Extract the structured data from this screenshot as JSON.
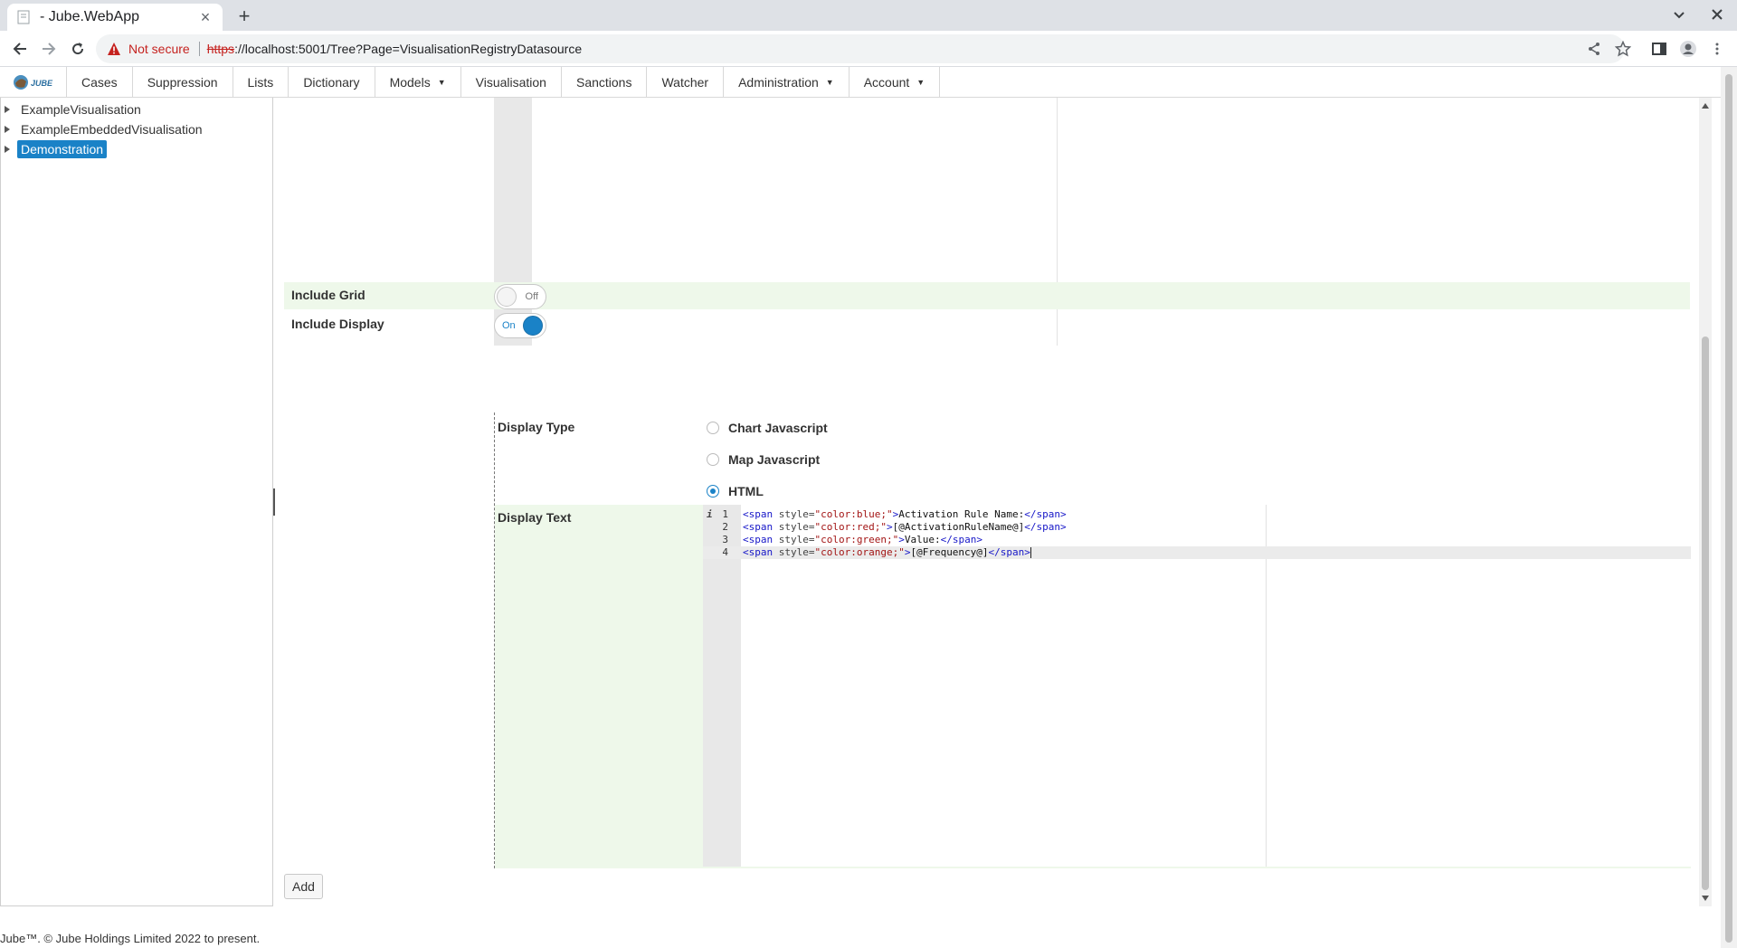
{
  "browser": {
    "tab_title": "- Jube.WebApp",
    "tab_close_icon": "close-icon",
    "new_tab_icon": "plus-icon",
    "security_label": "Not secure",
    "url_scheme": "https",
    "url_rest": "://localhost:5001/Tree?Page=VisualisationRegistryDatasource"
  },
  "menu": {
    "logo_text": "JUBE",
    "items": [
      {
        "label": "Cases",
        "dropdown": false
      },
      {
        "label": "Suppression",
        "dropdown": false
      },
      {
        "label": "Lists",
        "dropdown": false
      },
      {
        "label": "Dictionary",
        "dropdown": false
      },
      {
        "label": "Models",
        "dropdown": true
      },
      {
        "label": "Visualisation",
        "dropdown": false
      },
      {
        "label": "Sanctions",
        "dropdown": false
      },
      {
        "label": "Watcher",
        "dropdown": false
      },
      {
        "label": "Administration",
        "dropdown": true
      },
      {
        "label": "Account",
        "dropdown": true
      }
    ]
  },
  "tree": {
    "items": [
      {
        "label": "ExampleVisualisation",
        "selected": false
      },
      {
        "label": "ExampleEmbeddedVisualisation",
        "selected": false
      },
      {
        "label": "Demonstration",
        "selected": true
      }
    ]
  },
  "form": {
    "include_grid": {
      "label": "Include Grid",
      "state": "Off"
    },
    "include_display": {
      "label": "Include Display",
      "state": "On"
    },
    "display_type": {
      "label": "Display Type",
      "options": [
        {
          "label": "Chart Javascript",
          "checked": false
        },
        {
          "label": "Map Javascript",
          "checked": false
        },
        {
          "label": "HTML",
          "checked": true
        }
      ]
    },
    "display_text": {
      "label": "Display Text",
      "info_marker": "i",
      "lines": [
        {
          "num": "1",
          "tag_open": "<span",
          "attr": " style=",
          "str": "\"color:blue;\"",
          "close": ">",
          "text": "Activation Rule Name:",
          "end": "</span>"
        },
        {
          "num": "2",
          "tag_open": "<span",
          "attr": " style=",
          "str": "\"color:red;\"",
          "close": ">",
          "text": "[@ActivationRuleName@]",
          "end": "</span>"
        },
        {
          "num": "3",
          "tag_open": "<span",
          "attr": " style=",
          "str": "\"color:green;\"",
          "close": ">",
          "text": "Value:",
          "end": "</span>"
        },
        {
          "num": "4",
          "tag_open": "<span",
          "attr": " style=",
          "str": "\"color:orange;\"",
          "close": ">",
          "text": "[@Frequency@]",
          "end": "</span>"
        }
      ]
    },
    "add_button": "Add"
  },
  "footer": {
    "text": "Jube™. © Jube Holdings Limited 2022 to present."
  },
  "colors": {
    "accent": "#1a82c7",
    "row_highlight": "#eef8ea",
    "warning": "#c5221f"
  }
}
